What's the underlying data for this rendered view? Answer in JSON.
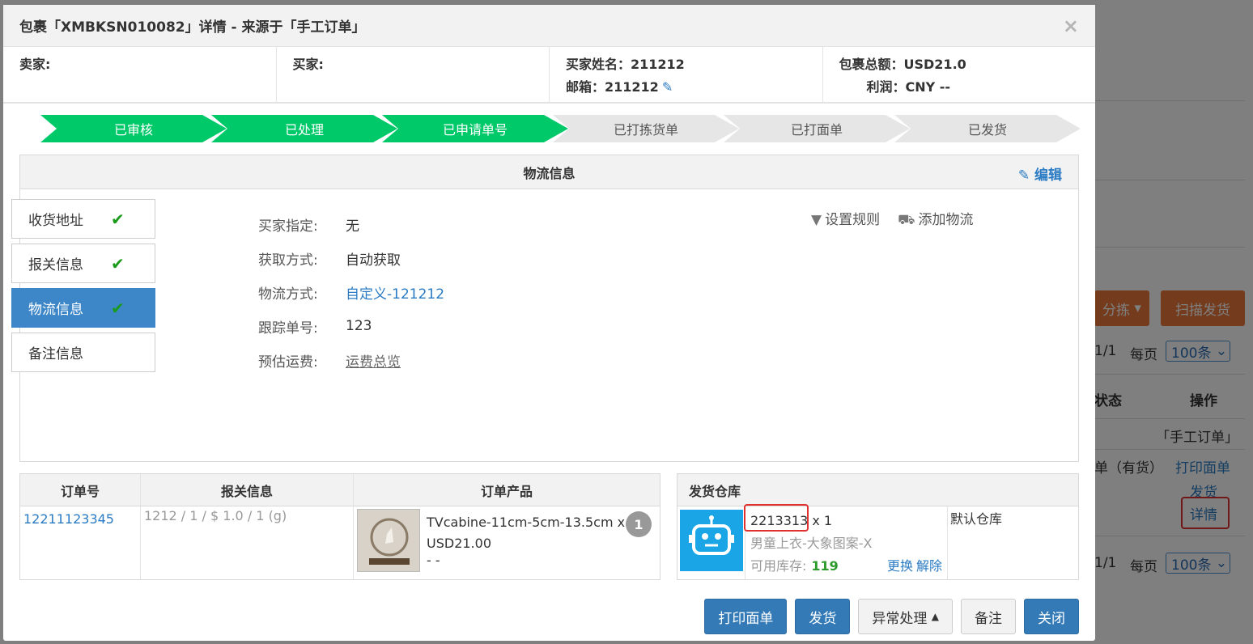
{
  "modal": {
    "title": "包裹「XMBKSN010082」详情 - 来源于「手工订单」",
    "close": "×"
  },
  "info": {
    "seller_label": "卖家:",
    "buyer_label": "买家:",
    "buyer_name": "买家姓名：211212",
    "email": "邮箱：211212",
    "total": "包裹总额：USD21.0",
    "profit": "利润：CNY --"
  },
  "steps": [
    "已审核",
    "已处理",
    "已申请单号",
    "已打拣货单",
    "已打面单",
    "已发货"
  ],
  "steps_done": 3,
  "panel": {
    "title": "物流信息",
    "edit": "编辑"
  },
  "side_tabs": [
    {
      "label": "收货地址",
      "checked": true,
      "active": false
    },
    {
      "label": "报关信息",
      "checked": true,
      "active": false
    },
    {
      "label": "物流信息",
      "checked": true,
      "active": true
    },
    {
      "label": "备注信息",
      "checked": false,
      "active": false
    }
  ],
  "fields": [
    {
      "label": "买家指定:",
      "value": "无",
      "style": "plain"
    },
    {
      "label": "获取方式:",
      "value": "自动获取",
      "style": "plain"
    },
    {
      "label": "物流方式:",
      "value": "自定义-121212",
      "style": "link"
    },
    {
      "label": "跟踪单号:",
      "value": "123",
      "style": "plain"
    },
    {
      "label": "预估运费:",
      "value": "运费总览",
      "style": "underline"
    }
  ],
  "tools": {
    "set_rules": "设置规则",
    "add_logistics": "添加物流"
  },
  "order_table": {
    "headers": [
      "订单号",
      "报关信息",
      "订单产品"
    ],
    "order_no": "12211123345",
    "customs": "1212 / 1 / $ 1.0 / 1 (g)",
    "product_name": "TVcabine-11cm-5cm-13.5cm x",
    "product_price": "USD21.00",
    "product_extra": "- -",
    "qty_badge": "1"
  },
  "warehouse": {
    "header": "发货仓库",
    "sku": "2213313",
    "qty": "x 1",
    "name": "男童上衣-大象图案-X",
    "stock_label": "可用库存:",
    "stock_value": "119",
    "replace": "更换",
    "unbind": "解除",
    "default_wh": "默认仓库"
  },
  "buttons": {
    "print": "打印面单",
    "ship": "发货",
    "exception": "异常处理",
    "note": "备注",
    "close": "关闭"
  },
  "background": {
    "sort_btn": "分拣",
    "scan_btn": "扫描发货",
    "page1": "1/1",
    "per_page": "每页",
    "per_page_value": "100条",
    "status_col": "状态",
    "ops_col": "操作",
    "source": "「手工订单」",
    "stock_status": "单（有货）",
    "op_print": "打印面单",
    "op_ship": "发货",
    "op_detail": "详情",
    "page2": "1/1",
    "per_page2": "每页",
    "per_page_value2": "100条"
  },
  "colors": {
    "step_done": "#00c96a",
    "step_todo": "#e6e6e6",
    "primary": "#337ab7",
    "link": "#2a7bc3",
    "highlight": "#e03030"
  }
}
